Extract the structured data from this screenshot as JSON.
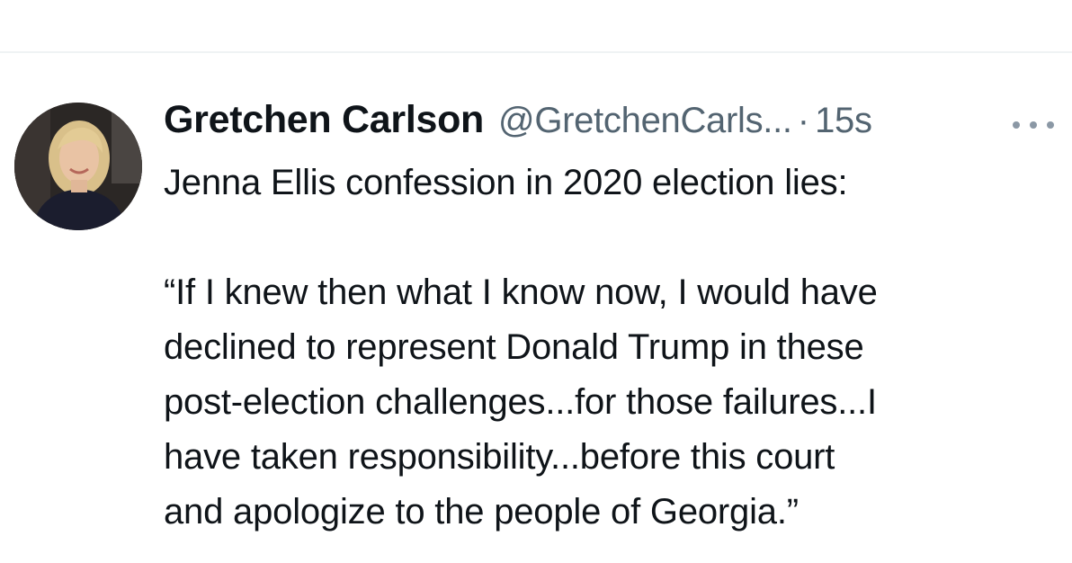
{
  "tweet": {
    "author_name": "Gretchen Carlson",
    "author_handle": "@GretchenCarls...",
    "separator": "·",
    "timestamp": "15s",
    "avatar_icon": "profile-photo",
    "more_icon": "more-dots-icon",
    "text_lines": [
      "Jenna Ellis confession in 2020 election lies:",
      "",
      "“If I knew then what I know now, I would have",
      "declined to represent Donald Trump in these",
      "post-election challenges...for those failures...I",
      "have taken responsibility...before this court",
      "and apologize to the people of Georgia.”"
    ]
  },
  "colors": {
    "primary_text": "#0f1419",
    "secondary_text": "#536471",
    "divider": "#eff3f4"
  }
}
